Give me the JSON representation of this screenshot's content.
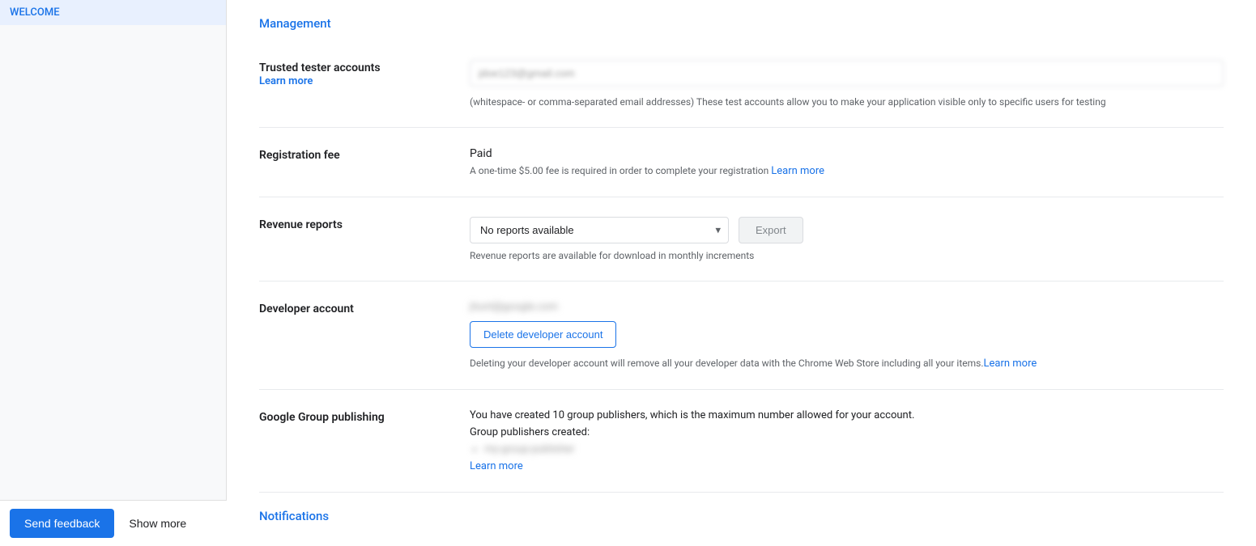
{
  "sidebar": {
    "welcome_label": "WELCOME",
    "send_feedback_label": "Send feedback",
    "show_more_label": "Show more"
  },
  "header": {
    "management_label": "Management"
  },
  "sections": {
    "trusted_tester": {
      "label": "Trusted tester accounts",
      "learn_more": "Learn more",
      "input_placeholder": "jdoe@gmail.com",
      "hint_text": "(whitespace- or comma-separated email addresses) These test accounts allow you to make your application visible only to specific users for testing"
    },
    "registration_fee": {
      "label": "Registration fee",
      "status": "Paid",
      "hint_text": "A one-time $5.00 fee is required in order to complete your registration",
      "learn_more": "Learn more"
    },
    "revenue_reports": {
      "label": "Revenue reports",
      "dropdown_value": "No reports available",
      "export_label": "Export",
      "hint_text": "Revenue reports are available for download in monthly increments",
      "dropdown_options": [
        "No reports available"
      ]
    },
    "developer_account": {
      "label": "Developer account",
      "account_blurred": "jhunt@google.com",
      "delete_btn_label": "Delete developer account",
      "hint_text": "Deleting your developer account will remove all your developer data with the Chrome Web Store including all your items.",
      "learn_more": "Learn more"
    },
    "google_group_publishing": {
      "label": "Google Group publishing",
      "description": "You have created 10 group publishers, which is the maximum number allowed for your account.",
      "created_label": "Group publishers created:",
      "publisher_blurred": "my-group-publisher",
      "learn_more": "Learn more"
    }
  },
  "notifications": {
    "label": "Notifications"
  }
}
